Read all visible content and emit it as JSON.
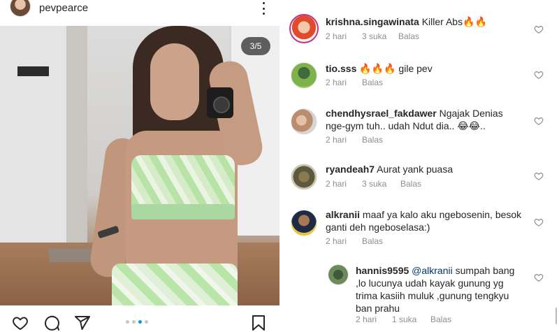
{
  "post": {
    "username": "pevpearce",
    "counter": "3/5",
    "carousel_active_index": 2,
    "carousel_count": 4
  },
  "comments": [
    {
      "user": "krishna.singawinata",
      "text": "Killer Abs🔥🔥",
      "time": "2 hari",
      "likes": "3 suka",
      "reply": "Balas"
    },
    {
      "user": "tio.sss",
      "text": "🔥🔥🔥 gile pev",
      "time": "2 hari",
      "likes": "",
      "reply": "Balas"
    },
    {
      "user": "chendhysrael_fakdawer",
      "text": "Ngajak Denias nge-gym tuh.. udah Ndut dia.. 😂😂..",
      "time": "2 hari",
      "likes": "",
      "reply": "Balas"
    },
    {
      "user": "ryandeah7",
      "text": "Aurat yank puasa",
      "time": "2 hari",
      "likes": "3 suka",
      "reply": "Balas"
    },
    {
      "user": "alkranii",
      "text": "maaf ya kalo aku ngebosenin, besok ganti deh ngeboselasa:)",
      "time": "2 hari",
      "likes": "",
      "reply": "Balas"
    }
  ],
  "reply": {
    "user": "hannis9595",
    "mention": "@alkranii",
    "text": "sumpah bang ,lo lucunya udah kayak gunung yg trima kasiih muluk ,gunung tengkyu ban prahu",
    "time": "2 hari",
    "likes": "1 suka",
    "reply": "Balas"
  },
  "colors": {
    "text": "#262626",
    "meta": "#8e8e8e",
    "accent": "#0095f6",
    "story_ring": "#c13584"
  },
  "icons": {
    "like": "heart-icon",
    "comment": "comment-icon",
    "share": "share-icon",
    "save": "bookmark-icon",
    "more": "more-icon"
  }
}
